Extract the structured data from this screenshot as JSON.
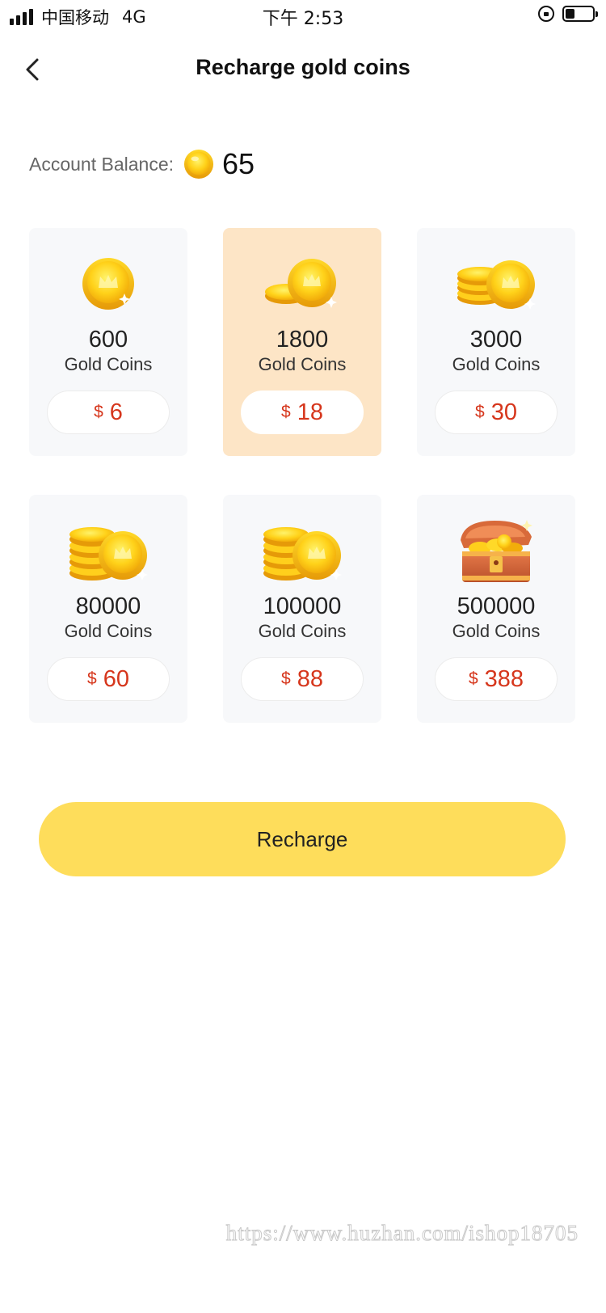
{
  "status_bar": {
    "carrier": "中国移动",
    "network": "4G",
    "time": "下午 2:53",
    "icons": [
      "signal-icon",
      "rotation-lock-icon",
      "battery-icon"
    ],
    "battery_level": 0.35
  },
  "header": {
    "title": "Recharge gold coins",
    "back_icon": "chevron-left-icon"
  },
  "balance": {
    "label": "Account Balance:",
    "value": "65",
    "icon": "gold-coin-icon"
  },
  "packages": [
    {
      "amount": "600",
      "unit": "Gold Coins",
      "currency": "$",
      "price": "6",
      "icon": "single-coin-icon",
      "selected": false
    },
    {
      "amount": "1800",
      "unit": "Gold Coins",
      "currency": "$",
      "price": "18",
      "icon": "two-coins-icon",
      "selected": true
    },
    {
      "amount": "3000",
      "unit": "Gold Coins",
      "currency": "$",
      "price": "30",
      "icon": "coin-stack-icon",
      "selected": false
    },
    {
      "amount": "80000",
      "unit": "Gold Coins",
      "currency": "$",
      "price": "60",
      "icon": "coin-stacks-icon",
      "selected": false
    },
    {
      "amount": "100000",
      "unit": "Gold Coins",
      "currency": "$",
      "price": "88",
      "icon": "coin-stacks-icon",
      "selected": false
    },
    {
      "amount": "500000",
      "unit": "Gold Coins",
      "currency": "$",
      "price": "388",
      "icon": "treasure-chest-icon",
      "selected": false
    }
  ],
  "recharge_button": {
    "label": "Recharge"
  },
  "watermark": "https://www.huzhan.com/ishop18705",
  "colors": {
    "accent": "#fedd5b",
    "selected_card": "#fde5c6",
    "card_bg": "#f7f8fa",
    "price": "#d6361c",
    "coin": "#f7c81e"
  }
}
